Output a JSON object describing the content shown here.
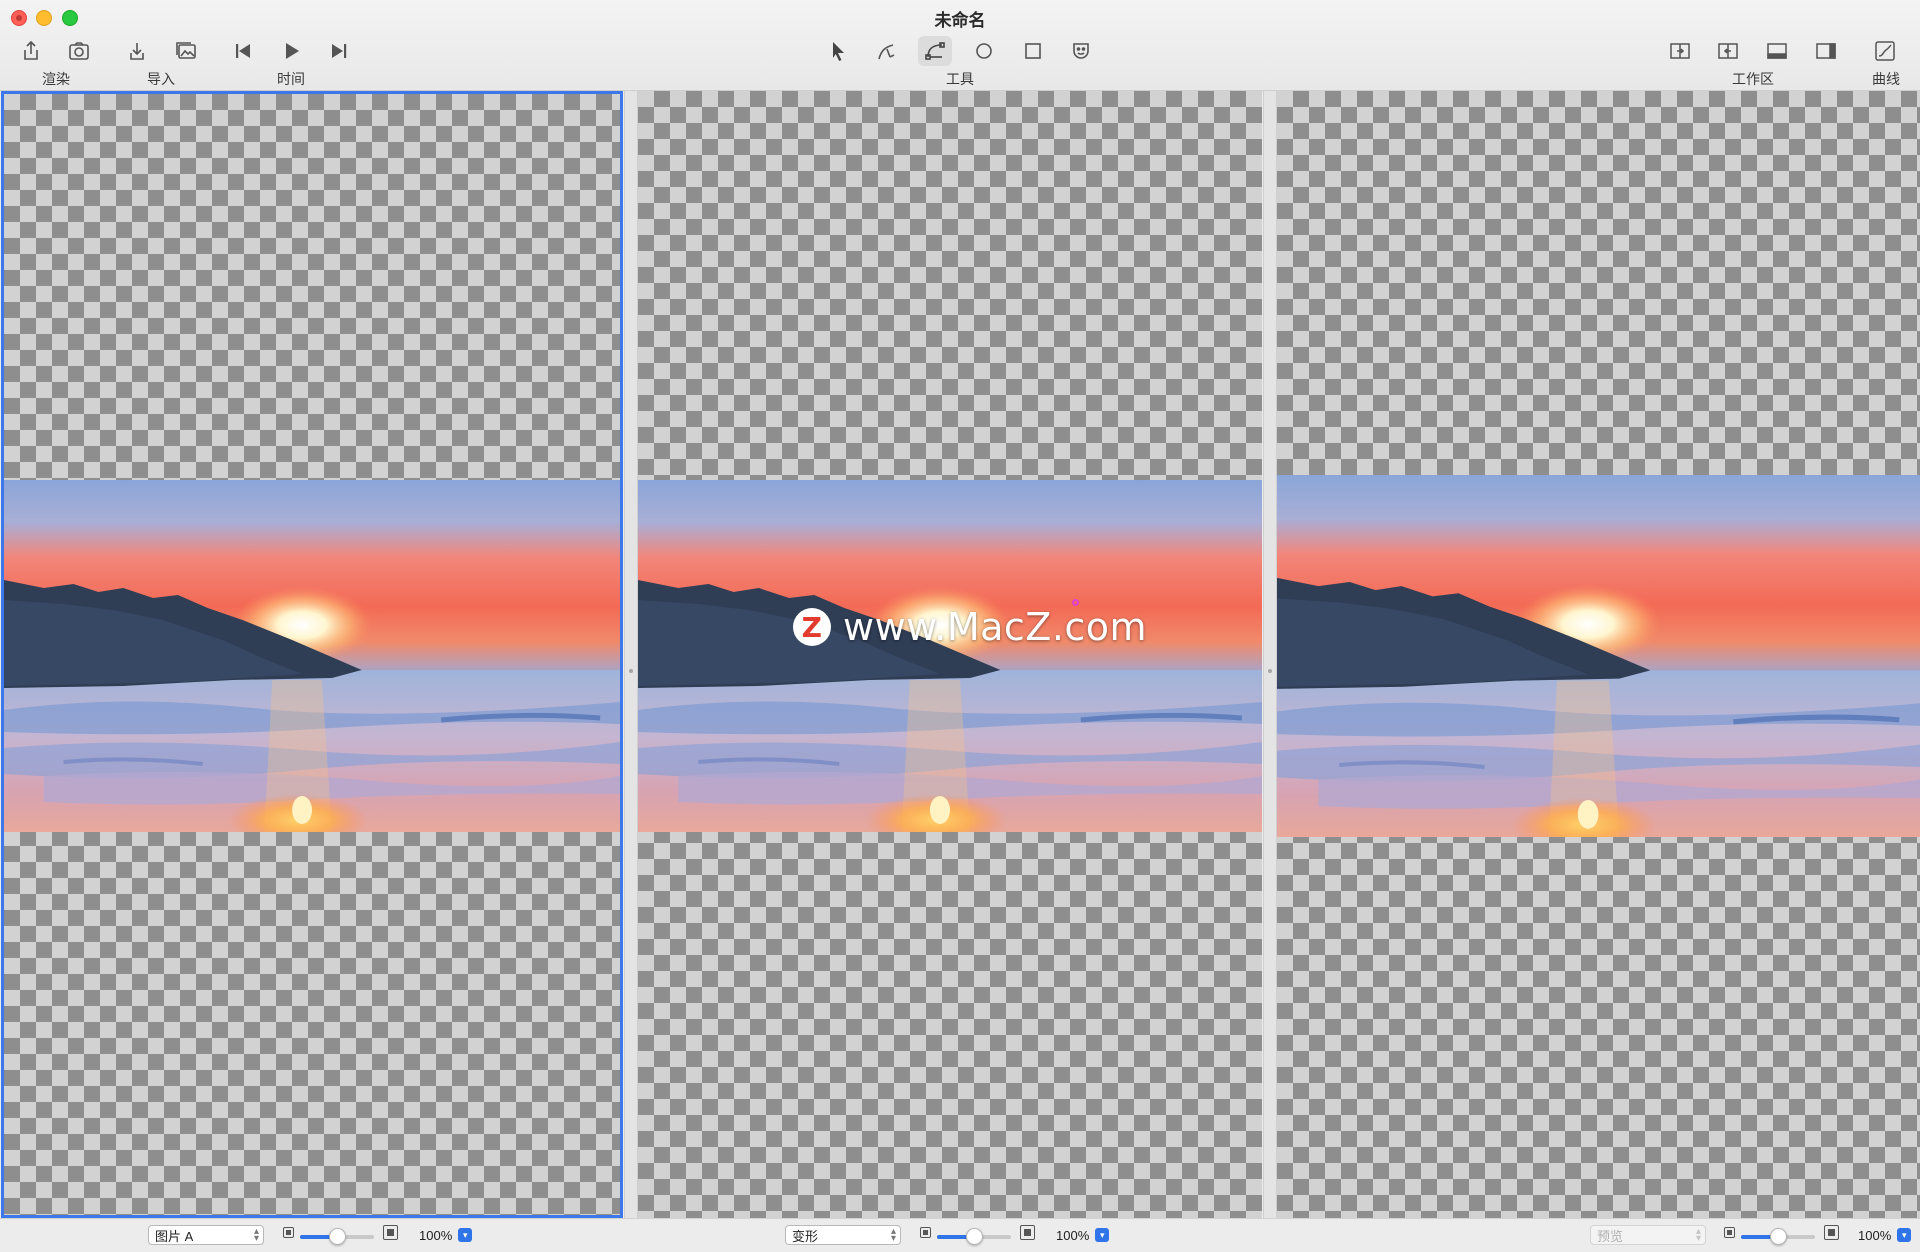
{
  "window": {
    "title": "未命名"
  },
  "toolbar": {
    "render_label": "渲染",
    "import_label": "导入",
    "time_label": "时间",
    "tools_label": "工具",
    "workspace_label": "工作区",
    "curve_label": "曲线"
  },
  "panes": {
    "watermark_text": "www.MacZ.com",
    "watermark_logo": "Z"
  },
  "bottom": {
    "left_select": "图片 A",
    "center_select": "变形",
    "right_select": "预览",
    "left_zoom": "100%",
    "center_zoom": "100%",
    "right_zoom": "100%",
    "left_slider": 0.5,
    "center_slider": 0.5,
    "right_slider": 0.5
  },
  "colors": {
    "accent": "#3c78ea",
    "slider_fill": "#2f74e8"
  },
  "icons": [
    "share-icon",
    "camera-icon",
    "import-icon",
    "image-icon",
    "skip-back-icon",
    "play-icon",
    "skip-forward-icon",
    "pointer-icon",
    "pen-icon",
    "bezier-icon",
    "ellipse-icon",
    "rectangle-icon",
    "face-icon",
    "workspace-split-icon",
    "workspace-merge-icon",
    "bottom-panel-icon",
    "right-panel-icon",
    "curve-icon"
  ]
}
